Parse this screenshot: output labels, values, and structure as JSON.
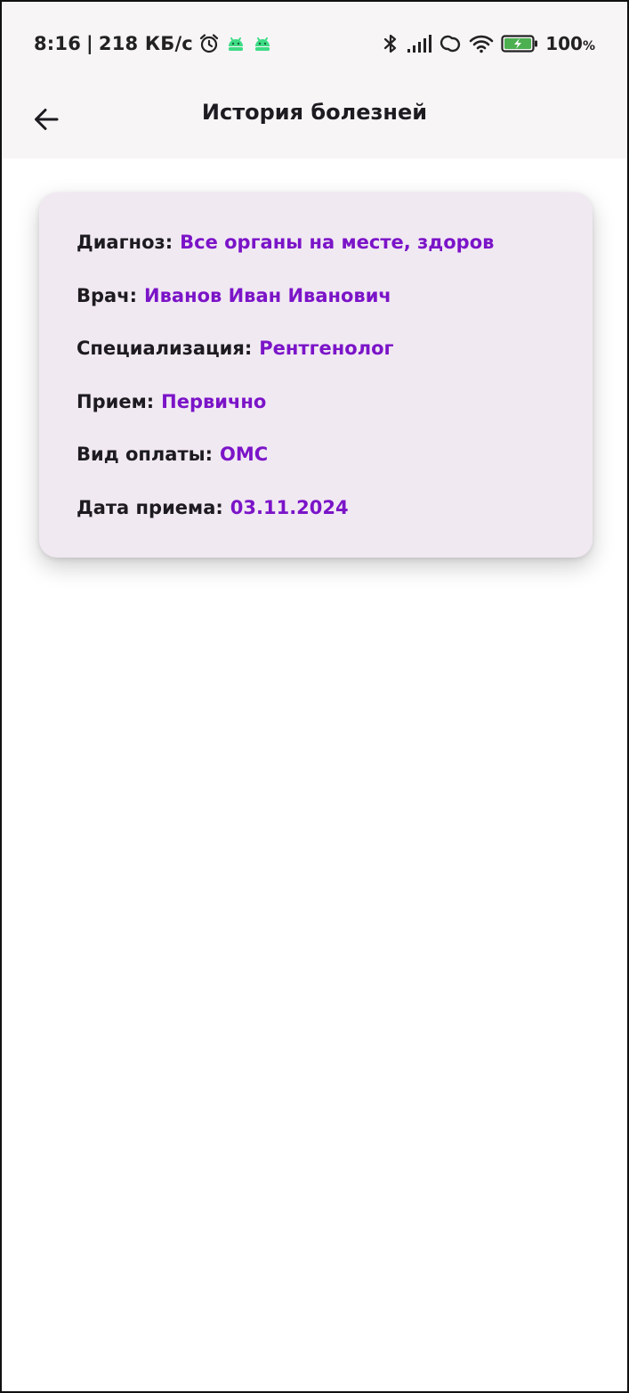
{
  "status_bar": {
    "time": "8:16",
    "separator": "|",
    "speed": "218 КБ/с",
    "battery_value": "100",
    "battery_unit": "%",
    "icons": [
      "alarm-icon",
      "android-icon",
      "android-icon",
      "bluetooth-icon",
      "signal-icon",
      "hotspot-icon",
      "wifi-icon",
      "battery-charging-icon"
    ],
    "colors": {
      "android": "#3ddc84",
      "battery": "#4caf50"
    }
  },
  "header": {
    "title": "История болезней",
    "back_icon": "arrow-back-icon"
  },
  "record": {
    "diagnosis_label": "Диагноз:",
    "diagnosis_value": "Все органы на месте, здоров",
    "doctor_label": "Врач:",
    "doctor_value": "Иванов Иван Иванович",
    "specialization_label": "Специализация:",
    "specialization_value": "Рентгенолог",
    "visit_label": "Прием:",
    "visit_value": "Первично",
    "payment_label": "Вид оплаты:",
    "payment_value": "ОМС",
    "date_label": "Дата приема:",
    "date_value": "03.11.2024"
  },
  "colors": {
    "accent": "#7b14c8",
    "card_background": "#f1e9f2",
    "appbar_background": "#f8f5f7"
  }
}
